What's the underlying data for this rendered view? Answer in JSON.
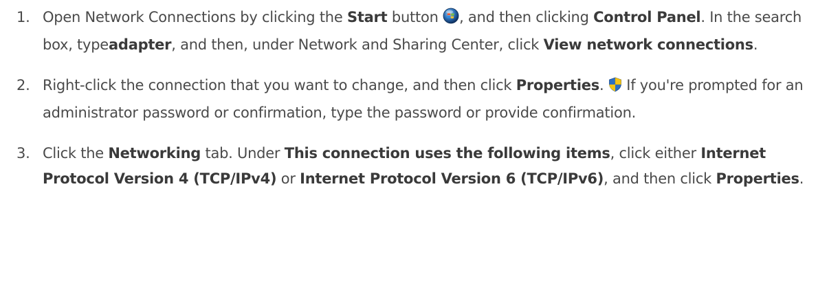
{
  "steps": [
    {
      "num": "1.",
      "t1": "Open Network Connections by clicking the ",
      "b1": "Start",
      "t2": " button ",
      "icon": "windows-start-orb-icon",
      "t3": ", and then clicking ",
      "b2": "Control Panel",
      "t4": ". In the search box, type",
      "b3": "adapter",
      "t5": ", and then, under Network and Sharing Center, click ",
      "b4": "View network connections",
      "t6": "."
    },
    {
      "num": "2.",
      "t1": "Right-click the connection that you want to change, and then click ",
      "b1": "Properties",
      "t2": ". ",
      "icon": "uac-shield-icon",
      "t3": " If you're prompted for an administrator password or confirmation, type the password or provide confirmation."
    },
    {
      "num": "3.",
      "t1": "Click the ",
      "b1": "Networking",
      "t2": " tab. Under ",
      "b2": "This connection uses the following items",
      "t3": ", click either ",
      "b3": "Internet Protocol Version 4 (TCP/IPv4)",
      "t4": " or ",
      "b4": "Internet Protocol Version 6 (TCP/IPv6)",
      "t5": ", and then click ",
      "b5": "Properties",
      "t6": "."
    }
  ]
}
